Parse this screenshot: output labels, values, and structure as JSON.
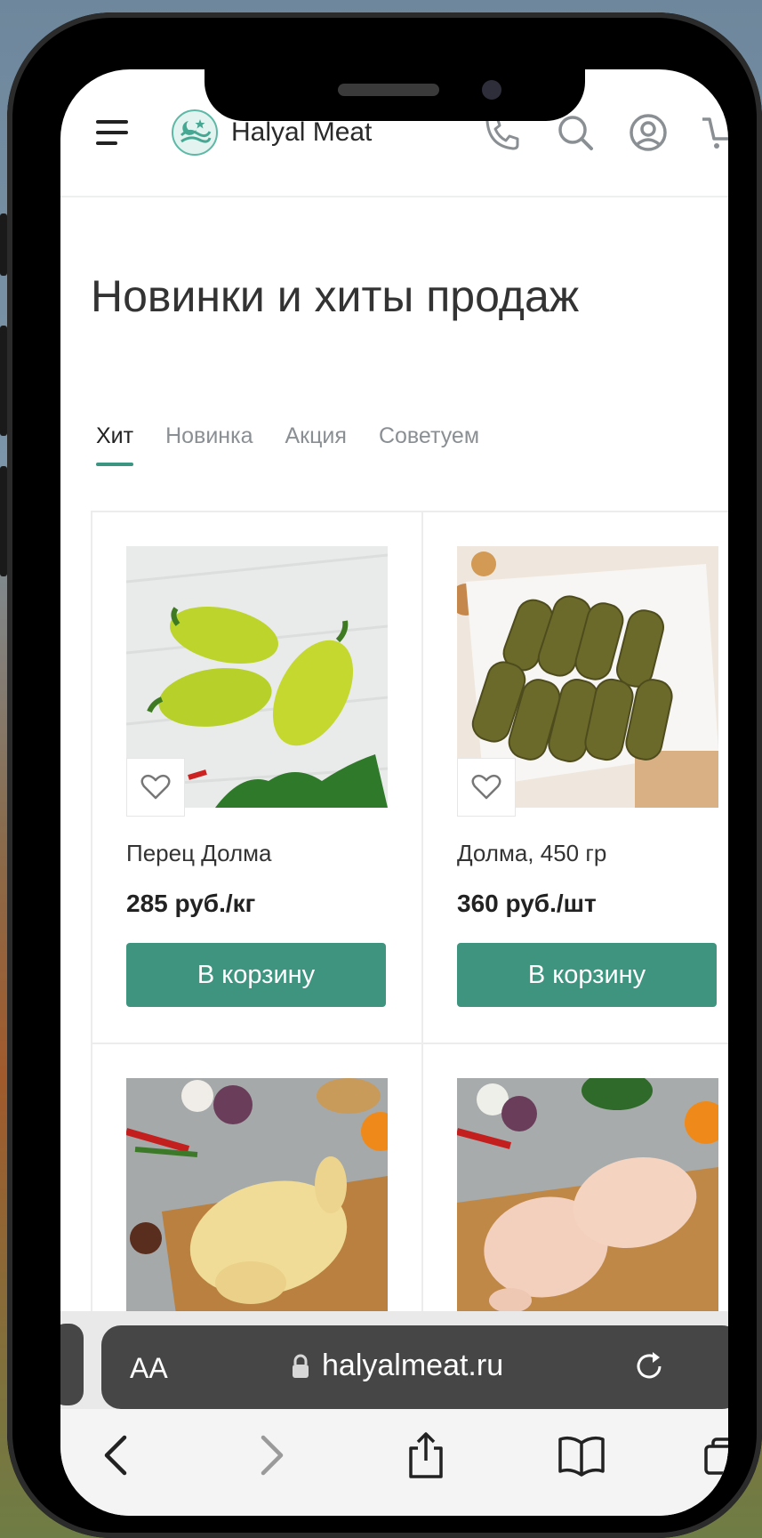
{
  "header": {
    "brand": "Halyal Meat",
    "icons": [
      "menu-icon",
      "logo",
      "phone-icon",
      "search-icon",
      "account-icon",
      "cart-icon"
    ]
  },
  "section": {
    "title": "Новинки и хиты продаж",
    "tabs": [
      {
        "label": "Хит",
        "active": true
      },
      {
        "label": "Новинка",
        "active": false
      },
      {
        "label": "Акция",
        "active": false
      },
      {
        "label": "Советуем",
        "active": false
      }
    ]
  },
  "products": [
    {
      "name": "Перец Долма",
      "price": "285 руб./кг",
      "button": "В корзину"
    },
    {
      "name": "Долма, 450 гр",
      "price": "360 руб./шт",
      "button": "В корзину"
    },
    {
      "name": "",
      "price": "",
      "button": ""
    },
    {
      "name": "",
      "price": "",
      "button": ""
    }
  ],
  "browser": {
    "aa_label": "AA",
    "url": "halyalmeat.ru"
  },
  "colors": {
    "accent": "#3f9480",
    "tab_underline": "#3b9581",
    "address_bar": "#464646"
  }
}
